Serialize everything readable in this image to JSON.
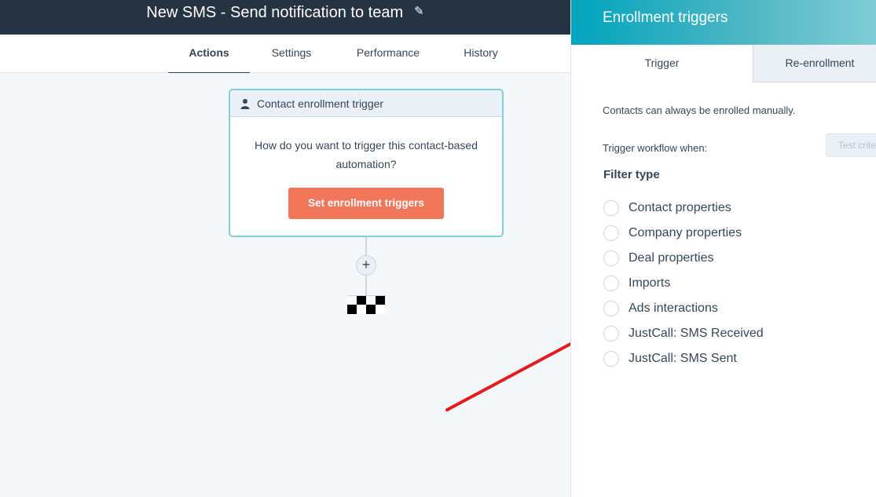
{
  "header": {
    "title": "New SMS - Send notification to team",
    "edit_icon": "pencil-icon"
  },
  "tabs": [
    {
      "label": "Actions",
      "active": true
    },
    {
      "label": "Settings",
      "active": false
    },
    {
      "label": "Performance",
      "active": false
    },
    {
      "label": "History",
      "active": false
    }
  ],
  "trigger_card": {
    "header": "Contact enrollment trigger",
    "header_icon": "person-icon",
    "question": "How do you want to trigger this contact-based automation?",
    "button_label": "Set enrollment triggers"
  },
  "canvas": {
    "add_label": "+",
    "end_icon": "checkered-flag-icon"
  },
  "panel": {
    "title": "Enrollment triggers",
    "tabs": [
      {
        "label": "Trigger",
        "active": true
      },
      {
        "label": "Re-enrollment",
        "active": false
      }
    ],
    "manual_note": "Contacts can always be enrolled manually.",
    "trigger_when": "Trigger workflow when:",
    "test_button": "Test criteria",
    "filter_type_heading": "Filter type",
    "filters": [
      "Contact properties",
      "Company properties",
      "Deal properties",
      "Imports",
      "Ads interactions",
      "JustCall: SMS Received",
      "JustCall: SMS Sent"
    ]
  },
  "colors": {
    "header_bg": "#253342",
    "accent_orange": "#f2765a",
    "teal": "#00a4bd",
    "annotation_arrow": "#e8191b"
  }
}
